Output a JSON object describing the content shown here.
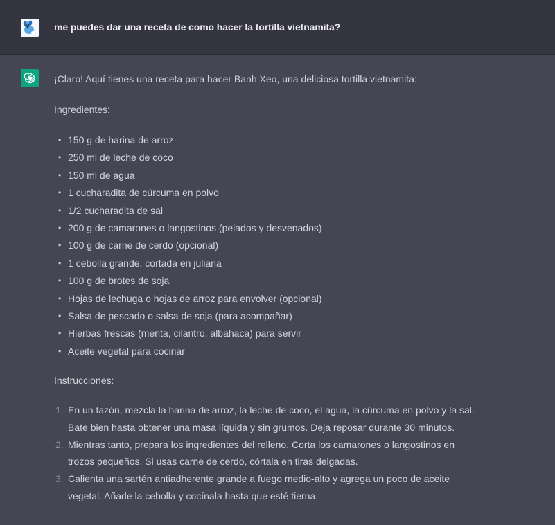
{
  "user_message": {
    "text": "me puedes dar una receta de como hacer la tortilla vietnamita?",
    "avatar_icon": "user-avatar-icon"
  },
  "assistant_message": {
    "avatar_icon": "openai-logo-icon",
    "intro": "¡Claro! Aquí tienes una receta para hacer Banh Xeo, una deliciosa tortilla vietnamita:",
    "ingredients_heading": "Ingredientes:",
    "ingredients": [
      "150 g de harina de arroz",
      "250 ml de leche de coco",
      "150 ml de agua",
      "1 cucharadita de cúrcuma en polvo",
      "1/2 cucharadita de sal",
      "200 g de camarones o langostinos (pelados y desvenados)",
      "100 g de carne de cerdo (opcional)",
      "1 cebolla grande, cortada en juliana",
      "100 g de brotes de soja",
      "Hojas de lechuga o hojas de arroz para envolver (opcional)",
      "Salsa de pescado o salsa de soja (para acompañar)",
      "Hierbas frescas (menta, cilantro, albahaca) para servir",
      "Aceite vegetal para cocinar"
    ],
    "instructions_heading": "Instrucciones:",
    "instructions": [
      {
        "num": "1.",
        "text": "En un tazón, mezcla la harina de arroz, la leche de coco, el agua, la cúrcuma en polvo y la sal. Bate bien hasta obtener una masa líquida y sin grumos. Deja reposar durante 30 minutos."
      },
      {
        "num": "2.",
        "text": "Mientras tanto, prepara los ingredientes del relleno. Corta los camarones o langostinos en trozos pequeños. Si usas carne de cerdo, córtala en tiras delgadas."
      },
      {
        "num": "3.",
        "text": "Calienta una sartén antiadherente grande a fuego medio-alto y agrega un poco de aceite vegetal. Añade la cebolla y cocínala hasta que esté tierna."
      }
    ]
  },
  "colors": {
    "user_bg": "#343541",
    "assistant_bg": "#444654",
    "text": "#d1d5db",
    "openai_green": "#10a37f"
  }
}
